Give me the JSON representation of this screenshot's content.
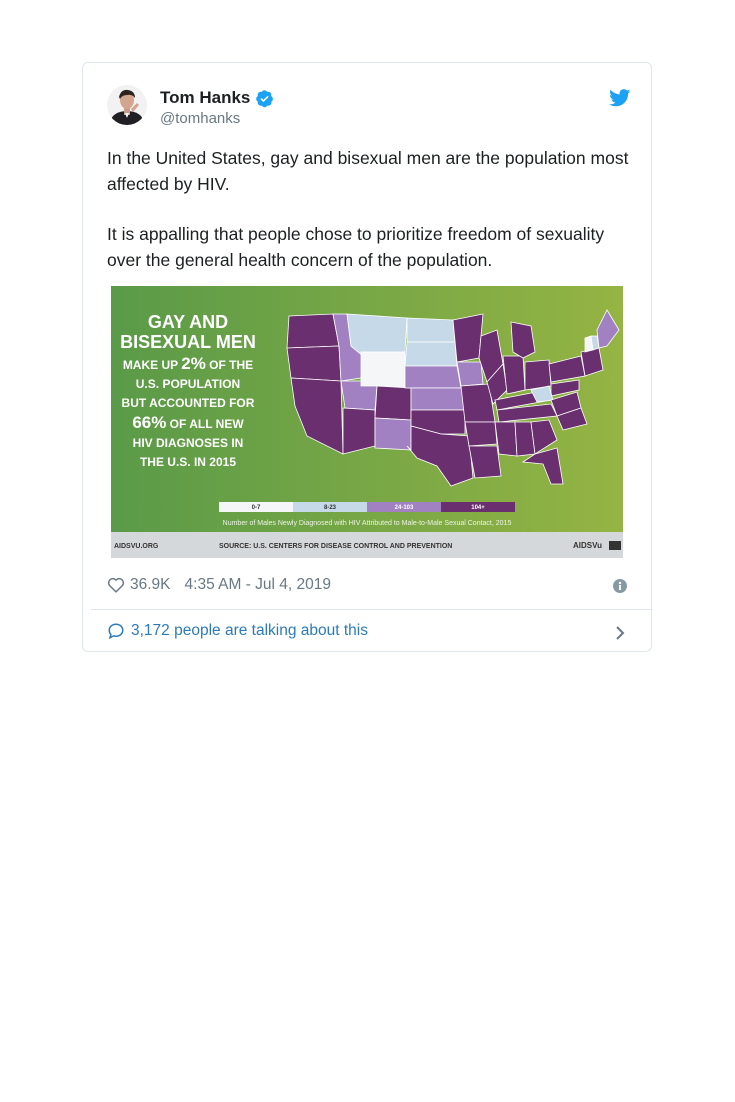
{
  "tweet": {
    "author_name": "Tom Hanks",
    "author_handle": "@tomhanks",
    "paragraph_1": "In the United States, gay and bisexual men are the population most affected by HIV.",
    "paragraph_2": "It is appalling that people chose to prioritize freedom of sexuality over the general health concern of the population.",
    "likes": "36.9K",
    "timestamp": "4:35 AM - Jul 4, 2019",
    "talking_link": "3,172 people are talking about this"
  },
  "infographic": {
    "headline_1": "GAY AND",
    "headline_2": "BISEXUAL MEN",
    "line_a_pre": "MAKE UP ",
    "line_a_num": "2%",
    "line_a_post": " OF THE",
    "line_b": "U.S. POPULATION",
    "line_c": "BUT ACCOUNTED FOR",
    "line_d_num": "66%",
    "line_d_post": " OF ALL NEW",
    "line_e": "HIV DIAGNOSES IN",
    "line_f": "THE U.S. IN 2015",
    "legend": [
      "0-7",
      "8-23",
      "24-103",
      "104+"
    ],
    "legend_caption": "Number of Males Newly Diagnosed with HIV Attributed to Male-to-Male Sexual Contact, 2015",
    "footer_left": "AIDSVU.ORG",
    "footer_center": "SOURCE: U.S. CENTERS FOR DISEASE CONTROL AND PREVENTION",
    "footer_right": "AIDSVu"
  },
  "icons": [
    "verified-icon",
    "twitter-bird-icon",
    "heart-icon",
    "info-icon",
    "comment-icon",
    "chevron-right-icon"
  ],
  "colors": {
    "link": "#2b7bb9",
    "twitter_blue": "#1da1f2",
    "map_dark": "#6a2f6f",
    "map_mid": "#a281c2",
    "map_light": "#c6d9e9",
    "map_white": "#f4f6f8"
  }
}
